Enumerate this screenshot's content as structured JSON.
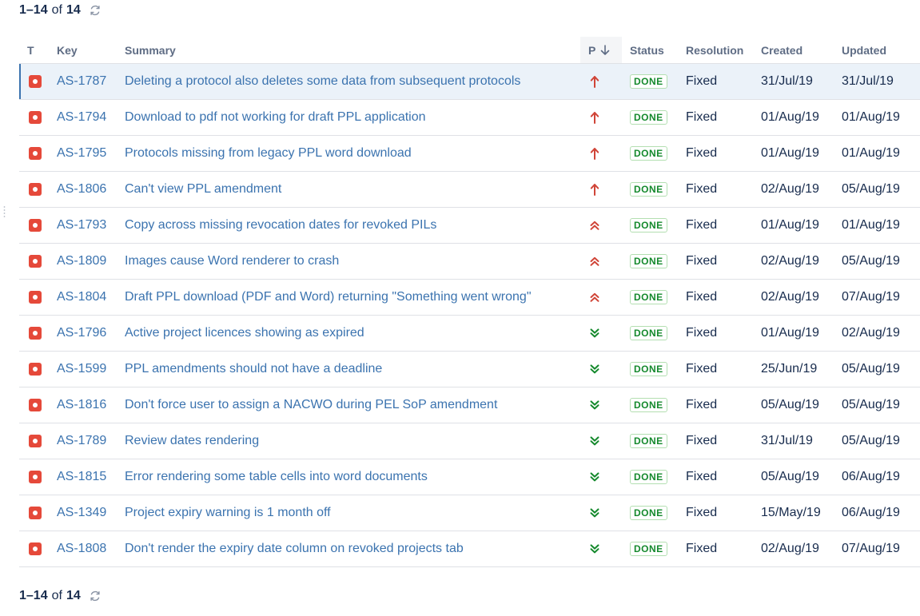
{
  "pager": {
    "range": "1–14",
    "of": "of",
    "total": "14",
    "refresh_icon": "refresh-icon"
  },
  "columns": {
    "type": "T",
    "key": "Key",
    "summary": "Summary",
    "priority": "P",
    "status": "Status",
    "resolution": "Resolution",
    "created": "Created",
    "updated": "Updated"
  },
  "colors": {
    "link": "#3b73af",
    "bug": "#e5493a",
    "priority_high": "#d04437",
    "priority_low": "#14892c",
    "status_done": "#14892c"
  },
  "rows": [
    {
      "key": "AS-1787",
      "summary": "Deleting a protocol also deletes some data from subsequent protocols",
      "priority": "highest-arrow-icon",
      "status": "DONE",
      "resolution": "Fixed",
      "created": "31/Jul/19",
      "updated": "31/Jul/19"
    },
    {
      "key": "AS-1794",
      "summary": "Download to pdf not working for draft PPL application",
      "priority": "highest-arrow-icon",
      "status": "DONE",
      "resolution": "Fixed",
      "created": "01/Aug/19",
      "updated": "01/Aug/19"
    },
    {
      "key": "AS-1795",
      "summary": "Protocols missing from legacy PPL word download",
      "priority": "highest-arrow-icon",
      "status": "DONE",
      "resolution": "Fixed",
      "created": "01/Aug/19",
      "updated": "01/Aug/19"
    },
    {
      "key": "AS-1806",
      "summary": "Can't view PPL amendment",
      "priority": "highest-arrow-icon",
      "status": "DONE",
      "resolution": "Fixed",
      "created": "02/Aug/19",
      "updated": "05/Aug/19"
    },
    {
      "key": "AS-1793",
      "summary": "Copy across missing revocation dates for revoked PILs",
      "priority": "high-double-chevron-icon",
      "status": "DONE",
      "resolution": "Fixed",
      "created": "01/Aug/19",
      "updated": "01/Aug/19"
    },
    {
      "key": "AS-1809",
      "summary": "Images cause Word renderer to crash",
      "priority": "high-double-chevron-icon",
      "status": "DONE",
      "resolution": "Fixed",
      "created": "02/Aug/19",
      "updated": "05/Aug/19"
    },
    {
      "key": "AS-1804",
      "summary": "Draft PPL download (PDF and Word) returning \"Something went wrong\"",
      "priority": "high-double-chevron-icon",
      "status": "DONE",
      "resolution": "Fixed",
      "created": "02/Aug/19",
      "updated": "07/Aug/19"
    },
    {
      "key": "AS-1796",
      "summary": "Active project licences showing as expired",
      "priority": "low-double-chevron-icon",
      "status": "DONE",
      "resolution": "Fixed",
      "created": "01/Aug/19",
      "updated": "02/Aug/19"
    },
    {
      "key": "AS-1599",
      "summary": "PPL amendments should not have a deadline",
      "priority": "low-double-chevron-icon",
      "status": "DONE",
      "resolution": "Fixed",
      "created": "25/Jun/19",
      "updated": "05/Aug/19"
    },
    {
      "key": "AS-1816",
      "summary": "Don't force user to assign a NACWO during PEL SoP amendment",
      "priority": "low-double-chevron-icon",
      "status": "DONE",
      "resolution": "Fixed",
      "created": "05/Aug/19",
      "updated": "05/Aug/19"
    },
    {
      "key": "AS-1789",
      "summary": "Review dates rendering",
      "priority": "low-double-chevron-icon",
      "status": "DONE",
      "resolution": "Fixed",
      "created": "31/Jul/19",
      "updated": "05/Aug/19"
    },
    {
      "key": "AS-1815",
      "summary": "Error rendering some table cells into word documents",
      "priority": "low-double-chevron-icon",
      "status": "DONE",
      "resolution": "Fixed",
      "created": "05/Aug/19",
      "updated": "06/Aug/19"
    },
    {
      "key": "AS-1349",
      "summary": "Project expiry warning is 1 month off",
      "priority": "low-double-chevron-icon",
      "status": "DONE",
      "resolution": "Fixed",
      "created": "15/May/19",
      "updated": "06/Aug/19"
    },
    {
      "key": "AS-1808",
      "summary": "Don't render the expiry date column on revoked projects tab",
      "priority": "low-double-chevron-icon",
      "status": "DONE",
      "resolution": "Fixed",
      "created": "02/Aug/19",
      "updated": "07/Aug/19"
    }
  ]
}
